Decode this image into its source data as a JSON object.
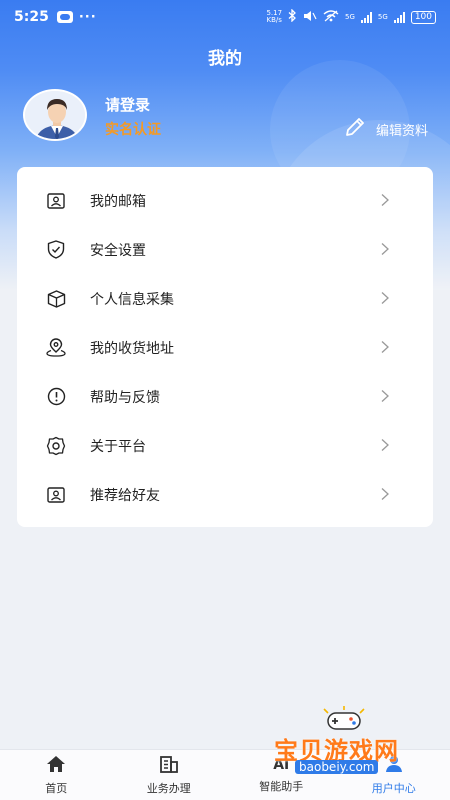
{
  "status_bar": {
    "time": "5:25",
    "dots": "···",
    "net_speed_top": "5.17",
    "net_speed_bottom": "KB/s",
    "signal_a": "5G",
    "signal_b": "5G",
    "battery": "100"
  },
  "header": {
    "title": "我的"
  },
  "profile": {
    "login": "请登录",
    "verify": "实名认证",
    "edit": "编辑资料"
  },
  "menu": {
    "items": [
      {
        "label": "我的邮箱",
        "icon": "mailbox-icon"
      },
      {
        "label": "安全设置",
        "icon": "shield-icon"
      },
      {
        "label": "个人信息采集",
        "icon": "box-icon"
      },
      {
        "label": "我的收货地址",
        "icon": "location-pin-icon"
      },
      {
        "label": "帮助与反馈",
        "icon": "alert-circle-icon"
      },
      {
        "label": "关于平台",
        "icon": "gear-icon"
      },
      {
        "label": "推荐给好友",
        "icon": "recommend-icon"
      }
    ]
  },
  "bottom_nav": {
    "items": [
      {
        "label": "首页",
        "icon": "home-icon"
      },
      {
        "label": "业务办理",
        "icon": "building-icon"
      },
      {
        "label": "智能助手",
        "icon": "ai-icon"
      },
      {
        "label": "用户中心",
        "icon": "user-icon"
      }
    ]
  },
  "watermark": {
    "title": "宝贝游戏网",
    "url": "baobeiy.com"
  },
  "colors": {
    "primary": "#2f7be8",
    "accent": "#f59a23",
    "watermark": "#ff7a1a"
  }
}
